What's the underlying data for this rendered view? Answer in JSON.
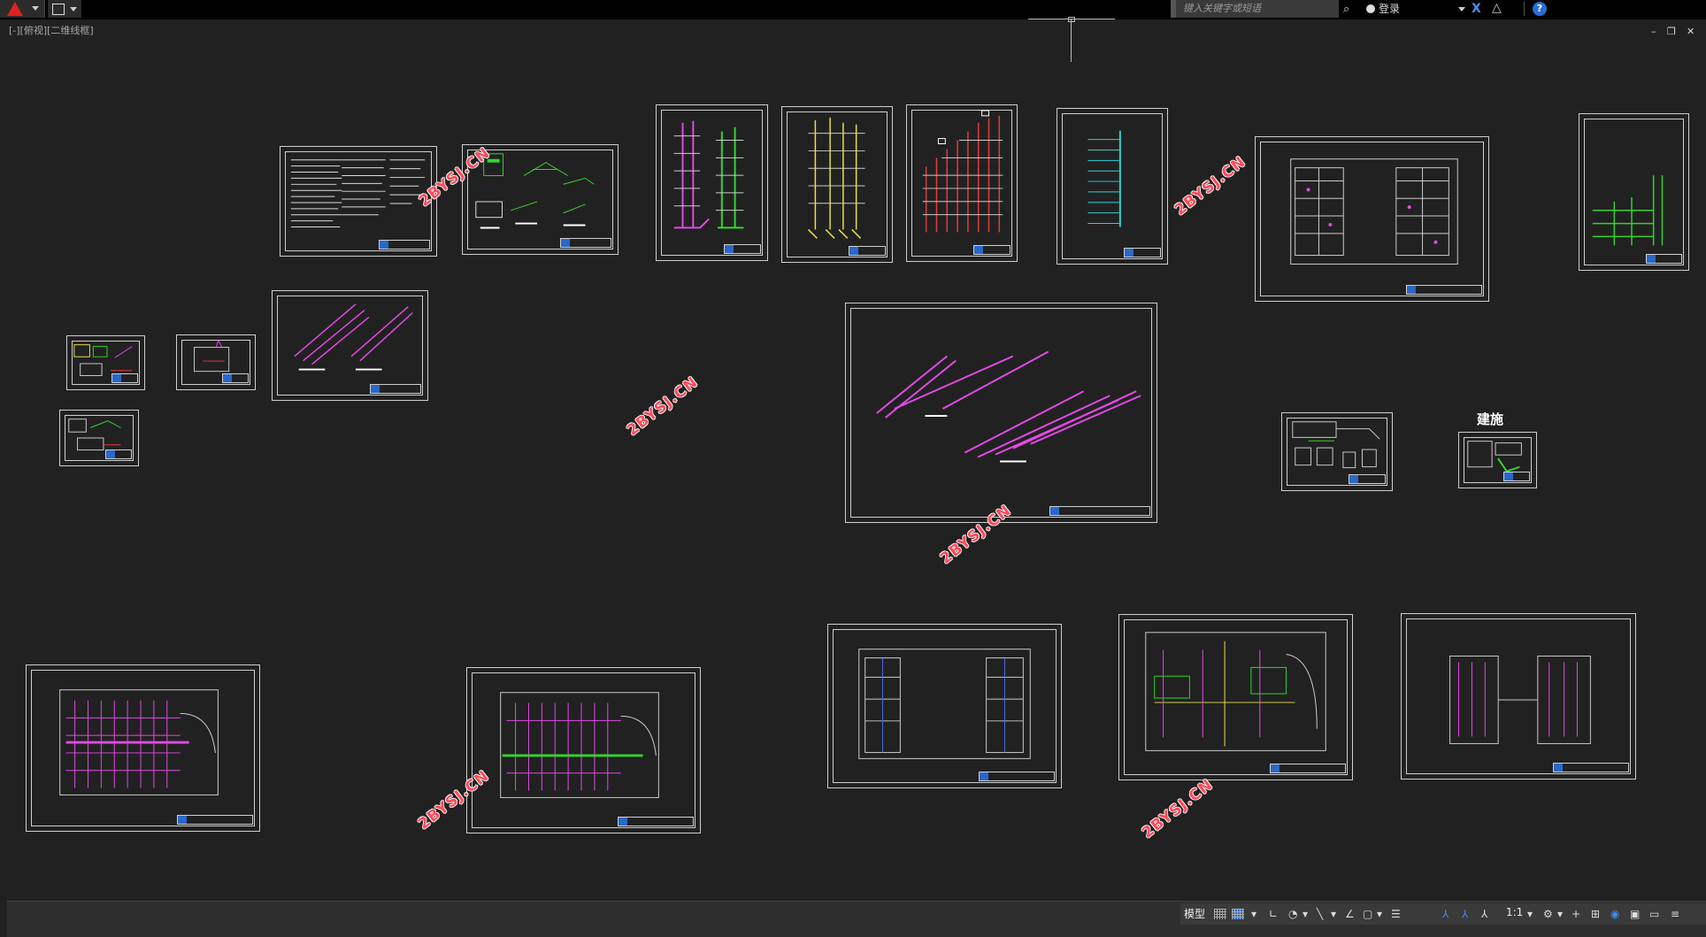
{
  "window": {
    "search_placeholder": "键入关键字或短语",
    "login_label": "登录",
    "help_label": "?"
  },
  "viewport": {
    "label": "[-][俯视][二维线框]",
    "minimize": "–",
    "restore": "❐",
    "close": "✕"
  },
  "drawing": {
    "label_building": "建施",
    "watermark": "2BYSJ.CN"
  },
  "statusbar": {
    "model_label": "模型",
    "scale_label": "1:1"
  },
  "colors": {
    "canvas": "#212121",
    "sheet_border": "#cfcfcf",
    "watermark": "#ff4a5a",
    "accent": "#3d8ef0"
  }
}
